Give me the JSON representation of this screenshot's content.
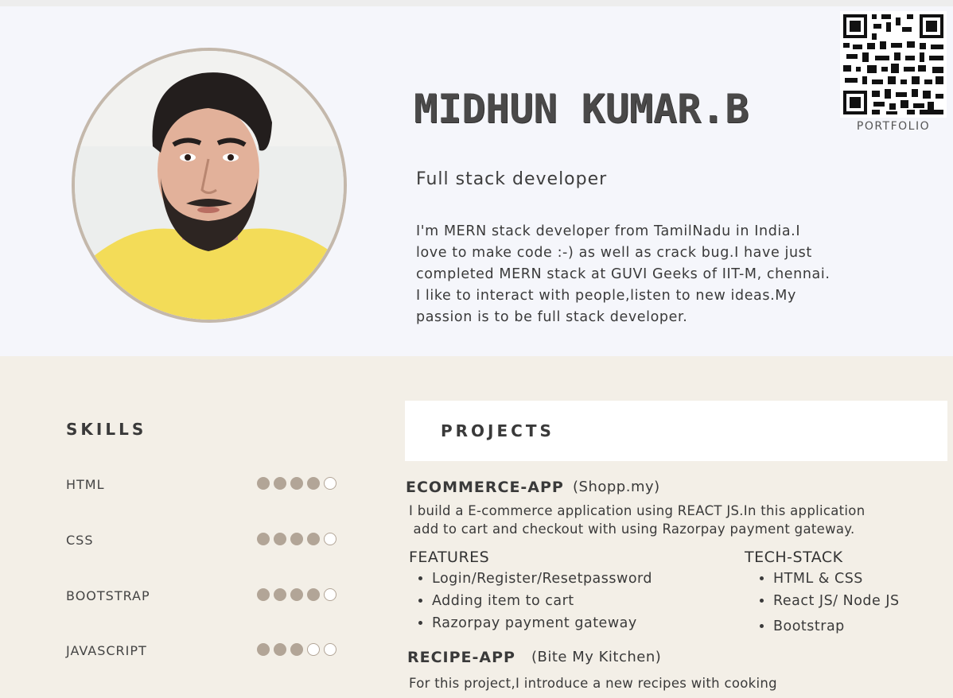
{
  "profile": {
    "name": "MIDHUN KUMAR.B",
    "role": "Full stack developer",
    "about_lines": [
      "I'm MERN stack developer from TamilNadu in India.I",
      "love to make code :-) as well as crack bug.I have just",
      "completed MERN stack at GUVI Geeks of IIT-M, chennai.",
      "I like to interact with people,listen to new ideas.My",
      "passion is to be full stack developer."
    ]
  },
  "qr": {
    "label": "PORTFOLIO"
  },
  "skills": {
    "title": "SKILLS",
    "items": [
      {
        "label": "HTML",
        "level": 4,
        "max": 5
      },
      {
        "label": "CSS",
        "level": 4,
        "max": 5
      },
      {
        "label": "BOOTSTRAP",
        "level": 4,
        "max": 5
      },
      {
        "label": "JAVASCRIPT",
        "level": 3,
        "max": 5
      }
    ]
  },
  "projects": {
    "title": "PROJECTS",
    "ecommerce": {
      "name": "ECOMMERCE-APP",
      "subtitle": "(Shopp.my)",
      "desc_lines": [
        "I build a E-commerce application using REACT JS.In this application",
        " add to cart and checkout with using Razorpay payment gateway."
      ],
      "features_title": "FEATURES",
      "features": [
        "Login/Register/Resetpassword",
        "Adding item to cart",
        "Razorpay payment gateway"
      ],
      "tech_title": "TECH-STACK",
      "tech": [
        "HTML & CSS",
        "React JS/ Node JS",
        "Bootstrap"
      ]
    },
    "recipe": {
      "name": "RECIPE-APP",
      "subtitle": "(Bite My Kitchen)",
      "desc_lines": [
        "For this project,I introduce a new recipes with cooking"
      ]
    }
  },
  "colors": {
    "dot_filled": "#b2a597",
    "avatar_ring": "#c4b8ab",
    "top_bg": "#f5f6fb",
    "bottom_bg": "#f3efe7"
  }
}
